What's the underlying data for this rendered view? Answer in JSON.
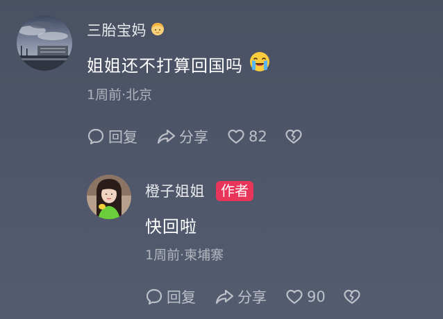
{
  "comments": [
    {
      "username": "三胎宝妈",
      "username_emoji": "person-blond-icon",
      "text": "姐姐还不打算回国吗",
      "text_emoji": "crying-face-icon",
      "meta": "1周前·北京",
      "actions": {
        "reply_label": "回复",
        "share_label": "分享",
        "like_count": "82"
      }
    },
    {
      "username": "橙子姐姐",
      "badge": "作者",
      "text": "快回啦",
      "meta": "1周前·柬埔寨",
      "actions": {
        "reply_label": "回复",
        "share_label": "分享",
        "like_count": "90"
      }
    }
  ],
  "colors": {
    "background": "#4f566a",
    "badge": "#e8365b",
    "meta_text": "#aeb2bc",
    "action_icon": "#c7cad2"
  }
}
